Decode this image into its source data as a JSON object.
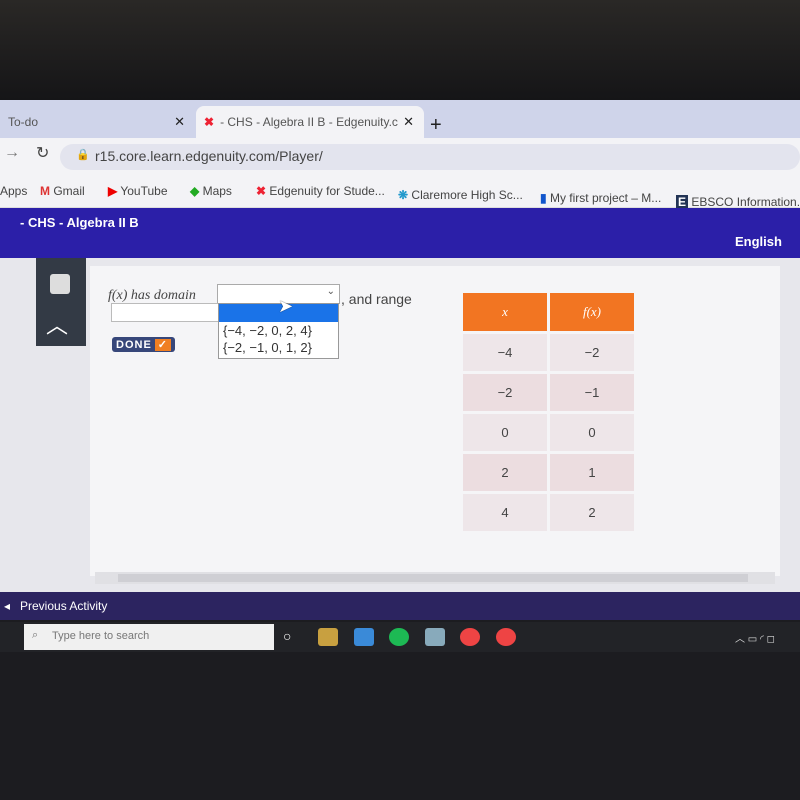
{
  "browser": {
    "tabs": [
      {
        "label": "To-do"
      },
      {
        "label": "- CHS - Algebra II B - Edgenuity.c"
      }
    ],
    "url": "r15.core.learn.edgenuity.com/Player/",
    "bookmarks": [
      "Apps",
      "Gmail",
      "YouTube",
      "Maps",
      "Edgenuity for Stude...",
      "Claremore High Sc...",
      "My first project – M...",
      "EBSCO Information..."
    ]
  },
  "header": {
    "course": "- CHS - Algebra II B",
    "language": "English"
  },
  "question": {
    "prefix": "f(x) has domain",
    "middle": ", and range",
    "dropdown_options": [
      "{−4, −2, 0, 2, 4}",
      "{−2, −1, 0, 1, 2}"
    ],
    "done_label": "DONE"
  },
  "table": {
    "headers": [
      "x",
      "f(x)"
    ],
    "rows": [
      [
        "−4",
        "−2"
      ],
      [
        "−2",
        "−1"
      ],
      [
        "0",
        "0"
      ],
      [
        "2",
        "1"
      ],
      [
        "4",
        "2"
      ]
    ]
  },
  "footer": {
    "previous": "Previous Activity"
  },
  "taskbar": {
    "search_placeholder": "Type here to search"
  },
  "colors": {
    "header": "#2b1fa8",
    "table_header": "#f27522",
    "highlight": "#1a73e8"
  }
}
